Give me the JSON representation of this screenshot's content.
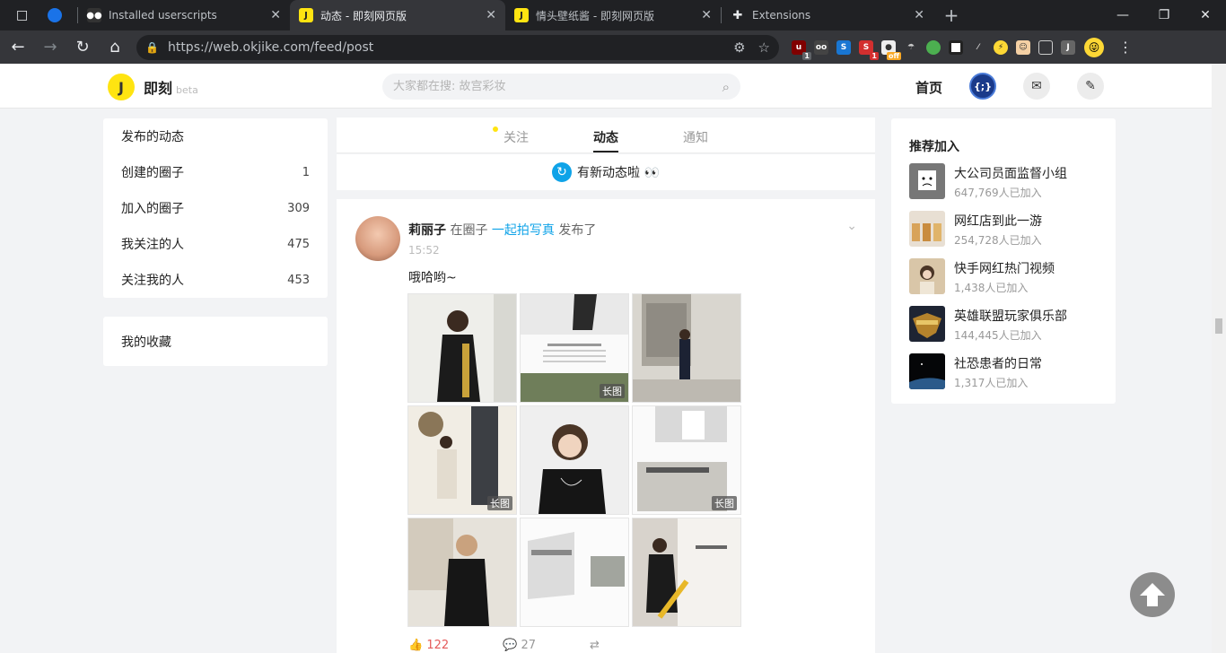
{
  "browser": {
    "tabs": [
      {
        "title": "Installed userscripts"
      },
      {
        "title": "动态 - 即刻网页版"
      },
      {
        "title": "情头壁纸酱 - 即刻网页版"
      },
      {
        "title": "Extensions"
      }
    ],
    "url": "https://web.okjike.com/feed/post"
  },
  "site": {
    "logo_letter": "J",
    "logo_text": "即刻",
    "beta": "beta",
    "search_placeholder": "大家都在搜: 故宫彩妆",
    "home": "首页",
    "user_avatar_text": "{;}"
  },
  "left_nav": [
    {
      "label": "发布的动态",
      "count": ""
    },
    {
      "label": "创建的圈子",
      "count": "1"
    },
    {
      "label": "加入的圈子",
      "count": "309"
    },
    {
      "label": "我关注的人",
      "count": "475"
    },
    {
      "label": "关注我的人",
      "count": "453"
    }
  ],
  "favorites": "我的收藏",
  "feed_tabs": [
    "关注",
    "动态",
    "通知"
  ],
  "new_posts": "有新动态啦 👀",
  "post": {
    "author": "莉丽子",
    "in_circle": "在圈子",
    "circle": "一起拍写真",
    "published": "发布了",
    "time": "15:52",
    "text": "哦哈哟~",
    "long_image_tag": "长图",
    "likes": "122",
    "comments": "27"
  },
  "recommend": {
    "title": "推荐加入",
    "items": [
      {
        "name": "大公司员面监督小组",
        "count": "647,769人已加入"
      },
      {
        "name": "网红店到此一游",
        "count": "254,728人已加入"
      },
      {
        "name": "快手网红热门视频",
        "count": "1,438人已加入"
      },
      {
        "name": "英雄联盟玩家俱乐部",
        "count": "144,445人已加入"
      },
      {
        "name": "社恐患者的日常",
        "count": "1,317人已加入"
      }
    ]
  }
}
